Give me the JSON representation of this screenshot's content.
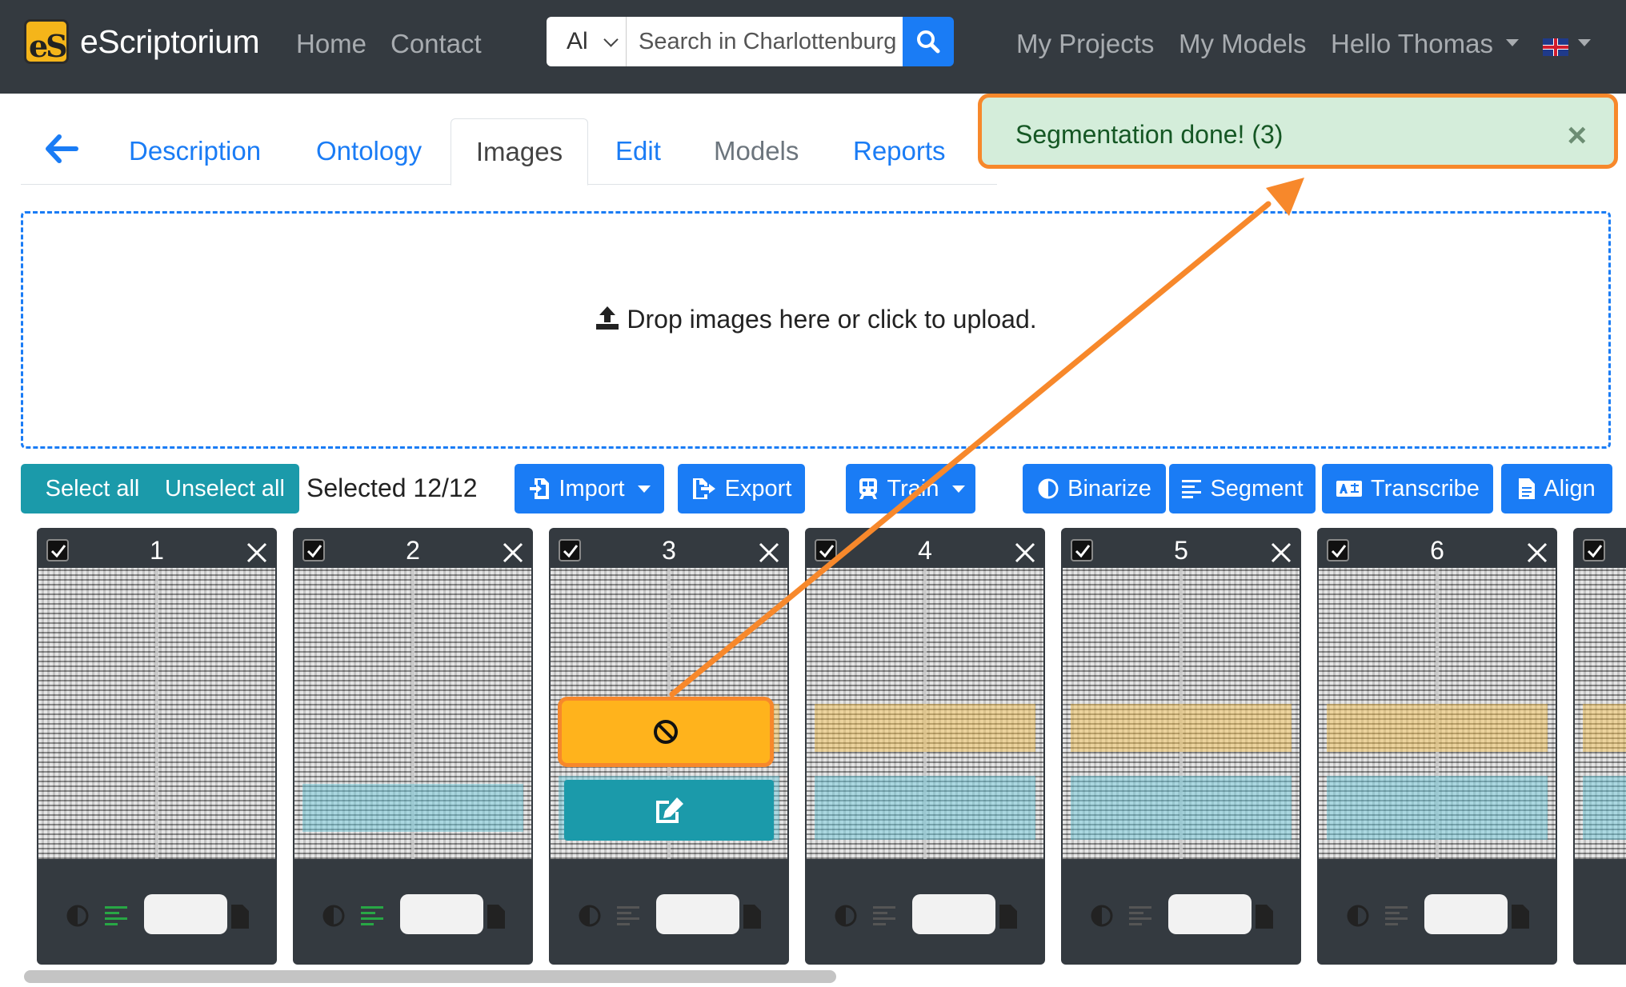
{
  "navbar": {
    "brand_logo": "eS",
    "brand": "eScriptorium",
    "links": [
      "Home",
      "Contact"
    ],
    "search": {
      "scope": "Al",
      "placeholder": "Search in Charlottenburg"
    },
    "right_links": [
      "My Projects",
      "My Models"
    ],
    "user": "Hello Thomas",
    "language_flag": "uk-flag-icon"
  },
  "tabs": {
    "items": [
      "Description",
      "Ontology",
      "Images",
      "Edit",
      "Models",
      "Reports"
    ],
    "active": "Images"
  },
  "toast": {
    "message": "Segmentation done! (3)",
    "close": "×"
  },
  "dropzone": {
    "text": "Drop images here or click to upload."
  },
  "toolbar": {
    "select_all": "Select all",
    "unselect_all": "Unselect all",
    "selected": "Selected 12/12",
    "import": "Import",
    "export": "Export",
    "train": "Train",
    "binarize": "Binarize",
    "segment": "Segment",
    "transcribe": "Transcribe",
    "align": "Align"
  },
  "cards": [
    {
      "number": "1",
      "segmented": true
    },
    {
      "number": "2",
      "segmented": true
    },
    {
      "number": "3",
      "segmented": false
    },
    {
      "number": "4",
      "segmented": false
    },
    {
      "number": "5",
      "segmented": false
    },
    {
      "number": "6",
      "segmented": false
    }
  ],
  "colors": {
    "navbar": "#343a40",
    "primary": "#1a7cf5",
    "teal": "#1b9aaa",
    "success_bg": "#d4edda",
    "annotation": "#f7882b",
    "warning": "#ffb31c"
  }
}
